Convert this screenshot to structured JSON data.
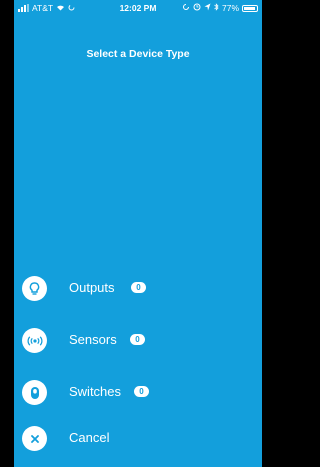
{
  "status_bar": {
    "carrier": "AT&T",
    "time": "12:02 PM",
    "battery": "77%"
  },
  "title": "Select a Device Type",
  "items": [
    {
      "label": "Outputs",
      "count": "0",
      "icon": "lightbulb-icon"
    },
    {
      "label": "Sensors",
      "count": "0",
      "icon": "sensor-waves-icon"
    },
    {
      "label": "Switches",
      "count": "0",
      "icon": "switch-icon"
    }
  ],
  "cancel": {
    "label": "Cancel",
    "icon": "close-icon"
  },
  "colors": {
    "background": "#139fdc",
    "foreground": "#ffffff"
  }
}
